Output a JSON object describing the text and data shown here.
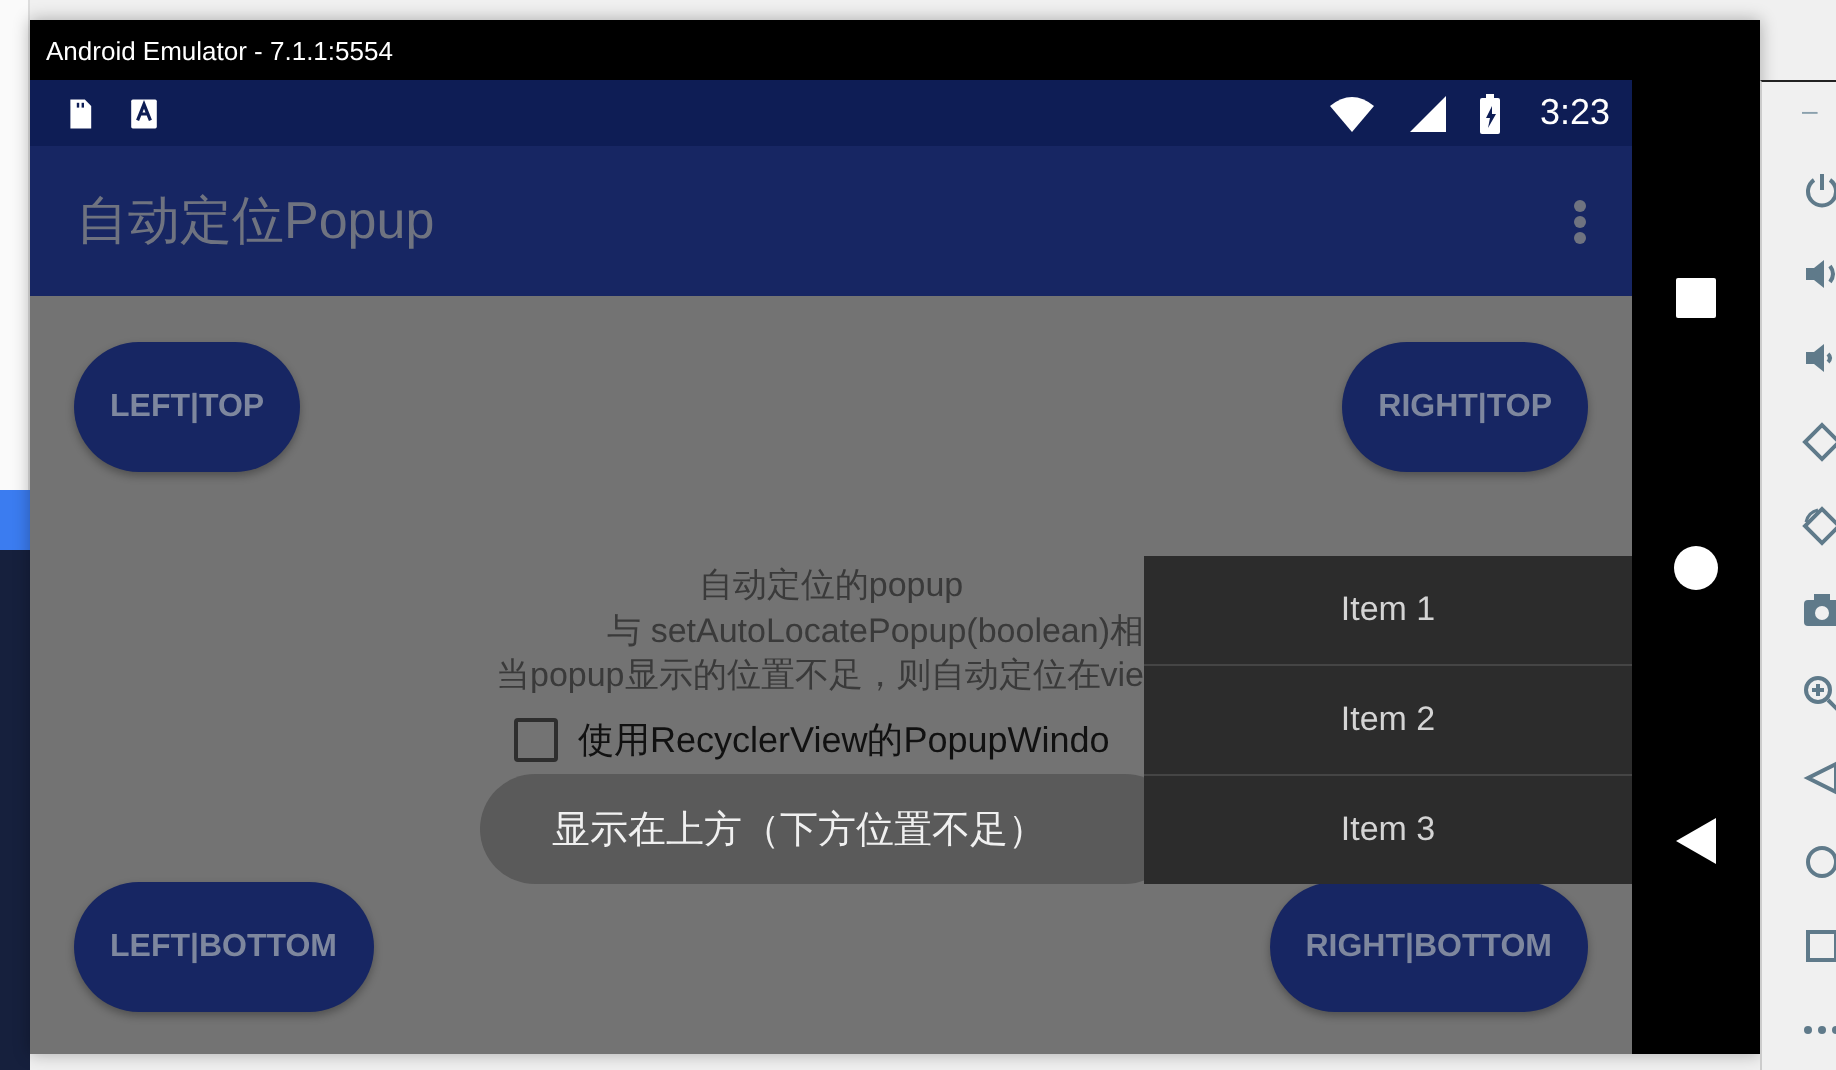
{
  "window": {
    "title": "Android Emulator - 7.1.1:5554"
  },
  "status_bar": {
    "time": "3:23"
  },
  "app_bar": {
    "title": "自动定位Popup"
  },
  "top_buttons": [
    "LEFT|TOP",
    "RIGHT|TOP"
  ],
  "description": [
    "自动定位的popup",
    "与 setAutoLocatePopup(boolean)相",
    "当popup显示的位置不足，则自动定位在vie"
  ],
  "checkbox": {
    "label": "使用RecyclerView的PopupWindo",
    "checked": false
  },
  "bottom_buttons": [
    "LEFT|BOTTOM",
    "RIGHT|BOTTOM"
  ],
  "toast": "显示在上方（下方位置不足）",
  "menu": {
    "items": [
      "Item 1",
      "Item 2",
      "Item 3"
    ]
  },
  "emulator_toolbar": {
    "minimize": "–"
  }
}
